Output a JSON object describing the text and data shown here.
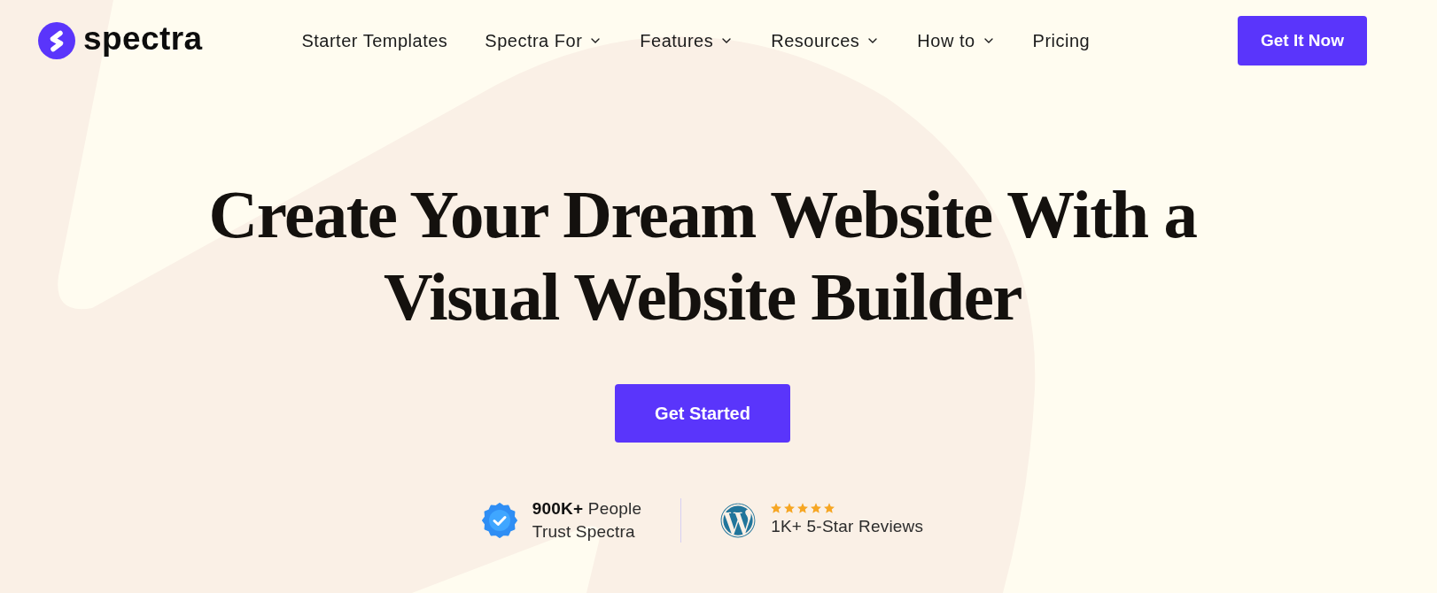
{
  "header": {
    "logo": {
      "wordmark": "spectra"
    },
    "nav": [
      {
        "label": "Starter Templates",
        "has_dropdown": false
      },
      {
        "label": "Spectra For",
        "has_dropdown": true
      },
      {
        "label": "Features",
        "has_dropdown": true
      },
      {
        "label": "Resources",
        "has_dropdown": true
      },
      {
        "label": "How to",
        "has_dropdown": true
      },
      {
        "label": "Pricing",
        "has_dropdown": false
      }
    ],
    "cta": "Get It Now"
  },
  "hero": {
    "headline_lines": [
      "Create Your Dream Website With a",
      "Visual Website Builder"
    ],
    "button": "Get Started"
  },
  "trust": [
    {
      "kind": "badge",
      "lines": [
        "**900K+** People",
        "Trust Spectra"
      ]
    },
    {
      "kind": "rating",
      "stars": 5,
      "lines": [
        "1K+ 5-Star Reviews"
      ]
    }
  ]
}
